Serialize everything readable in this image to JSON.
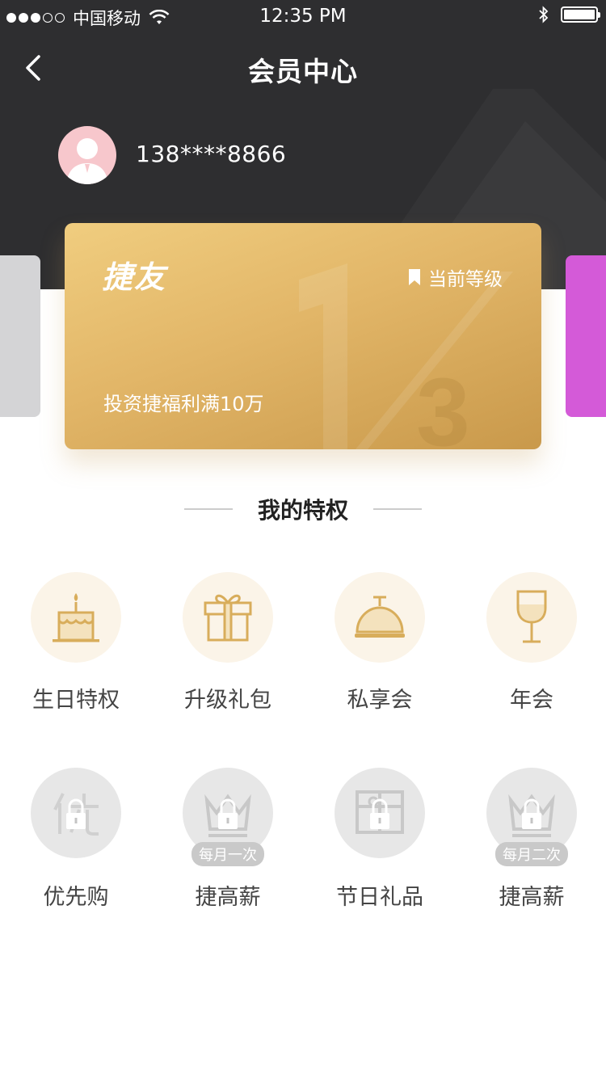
{
  "status_bar": {
    "carrier": "中国移动",
    "time": "12:35 PM"
  },
  "nav": {
    "title": "会员中心"
  },
  "user": {
    "phone": "138****8866"
  },
  "card": {
    "brand": "捷友",
    "level_label": "当前等级",
    "description": "投资捷福利满10万",
    "level_fraction": "1/3"
  },
  "section": {
    "title": "我的特权"
  },
  "privileges": [
    {
      "label": "生日特权",
      "icon": "cake-icon",
      "locked": false
    },
    {
      "label": "升级礼包",
      "icon": "gift-icon",
      "locked": false
    },
    {
      "label": "私享会",
      "icon": "cloche-icon",
      "locked": false
    },
    {
      "label": "年会",
      "icon": "wine-glass-icon",
      "locked": false
    },
    {
      "label": "优先购",
      "icon": "priority-icon",
      "locked": true
    },
    {
      "label": "捷高薪",
      "icon": "crown-icon",
      "locked": true,
      "badge": "每月一次"
    },
    {
      "label": "节日礼品",
      "icon": "present-box-icon",
      "locked": true
    },
    {
      "label": "捷高薪",
      "icon": "crown-icon",
      "locked": true,
      "badge": "每月二次"
    }
  ],
  "colors": {
    "header_bg": "#2e2e30",
    "gold": "#d8ad5b",
    "card_gold": "#e2b668",
    "grey_icon": "#c4c4c4"
  }
}
